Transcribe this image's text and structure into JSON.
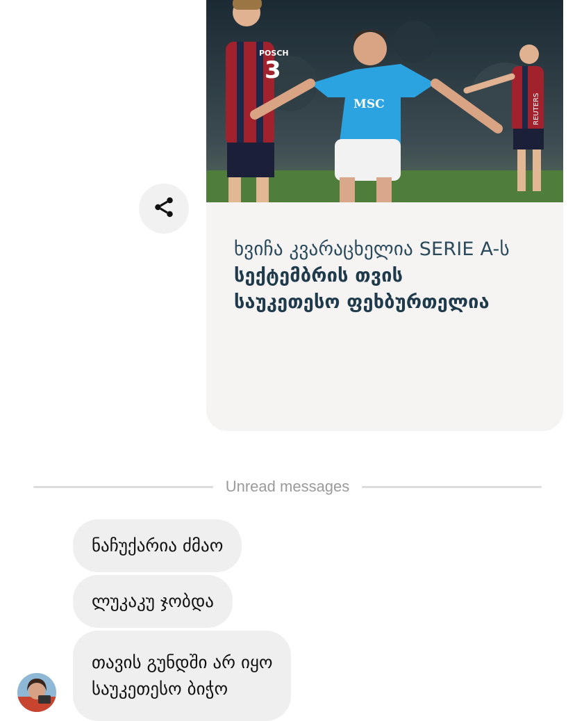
{
  "post": {
    "image_alt": "football player celebrating",
    "caption_line1": "ხვიჩა კვარაცხელია SERIE A-ს",
    "caption_line2": "სექტემბრის თვის",
    "caption_line3": "საუკეთესო ფეხბურთელია",
    "jersey_text_home": "MSC",
    "jersey_number_away": "3",
    "jersey_name_away": "POSCH",
    "watermark": "REUTERS"
  },
  "divider": {
    "label": "Unread messages"
  },
  "messages": [
    {
      "text": "ნაჩუქარია ძმაო"
    },
    {
      "text": "ლუკაკუ ჯობდა"
    },
    {
      "line1": "თავის გუნდში არ იყო",
      "line2": "საუკეთესო ბიჭო"
    }
  ],
  "colors": {
    "bubble": "#efefef",
    "card": "#f5f4f3",
    "caption": "#1e3a4b",
    "divider_text": "#9a9a9a"
  },
  "icons": {
    "share": "share-icon"
  }
}
